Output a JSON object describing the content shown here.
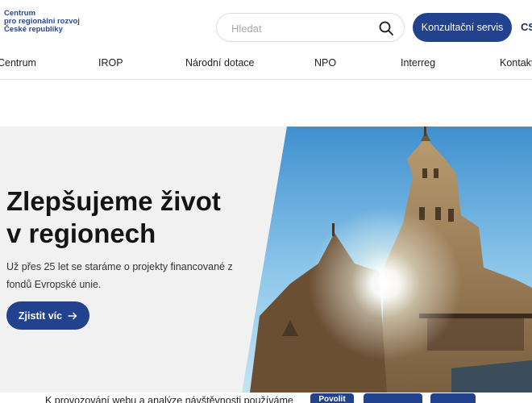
{
  "logo": {
    "lines": [
      "Centrum",
      "pro regionální rozvoj",
      "České republiky"
    ]
  },
  "search": {
    "placeholder": "Hledat",
    "icon": "search-icon"
  },
  "header": {
    "consult_label": "Konzultační servis",
    "lang": "CS"
  },
  "nav": {
    "items": [
      "Centrum",
      "IROP",
      "Národní dotace",
      "NPO",
      "Interreg",
      "Kontakty"
    ]
  },
  "hero": {
    "title_lines": [
      "Zlepšujeme život",
      "v regionech"
    ],
    "text": "Už přes 25 let se staráme o projekty financované z fondů Evropské unie.",
    "button_label": "Zjistit víc",
    "button_icon": "arrow-right-icon"
  },
  "cookie": {
    "text": "K provozování webu a analýze návštěvnosti používáme",
    "accept_label": "Povolit"
  },
  "colors": {
    "brand": "#23428d",
    "logo": "#2c4a8e"
  }
}
